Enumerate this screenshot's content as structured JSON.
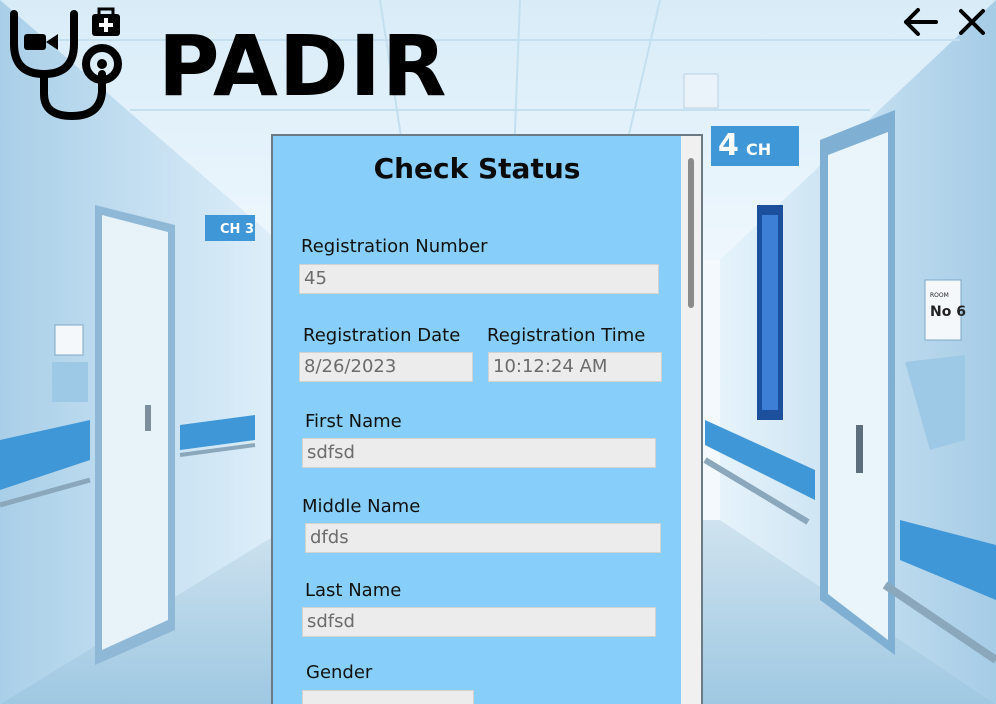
{
  "header": {
    "brand": "PADIR",
    "logo_icon": "stethoscope-medkit-icon",
    "back_icon": "arrow-left-icon",
    "close_icon": "close-icon"
  },
  "background": {
    "signs": {
      "ch3": "CH 3",
      "ch4_number": "4",
      "ch4_text": "CH",
      "room": "ROOM",
      "room_no": "No 6"
    }
  },
  "panel": {
    "title": "Check Status",
    "fields": {
      "registration_number": {
        "label": "Registration Number",
        "value": "45"
      },
      "registration_date": {
        "label": "Registration Date",
        "value": "8/26/2023"
      },
      "registration_time": {
        "label": "Registration Time",
        "value": "10:12:24 AM"
      },
      "first_name": {
        "label": "First Name",
        "value": "sdfsd"
      },
      "middle_name": {
        "label": "Middle Name",
        "value": "dfds"
      },
      "last_name": {
        "label": "Last Name",
        "value": "sdfsd"
      },
      "gender": {
        "label": "Gender",
        "value": ""
      }
    }
  },
  "colors": {
    "panel_bg": "#87cefa",
    "field_bg": "#ececec",
    "field_text": "#6c6c6c"
  }
}
